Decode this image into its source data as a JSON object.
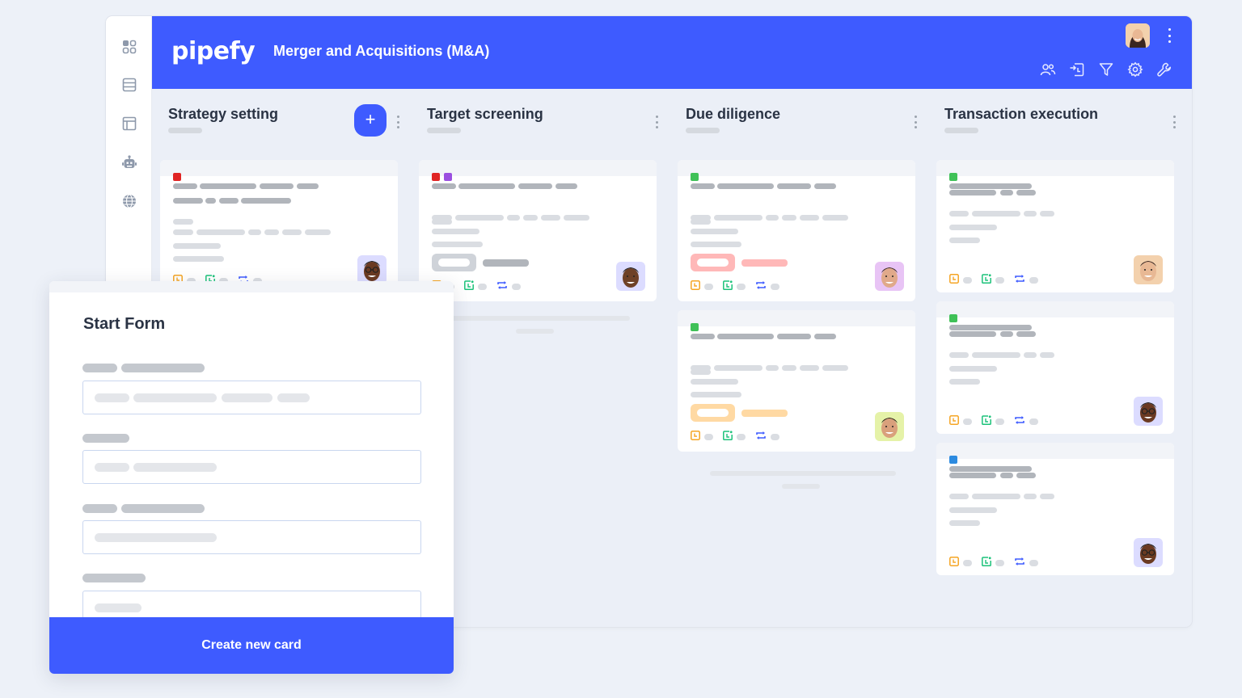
{
  "app": {
    "logo_text": "pipefy",
    "pipe_title": "Merger and Acquisitions (M&A)",
    "brand_color": "#3e5bff"
  },
  "sidebar": {
    "items": [
      {
        "icon": "apps-grid-icon"
      },
      {
        "icon": "database-icon"
      },
      {
        "icon": "layout-panel-icon"
      },
      {
        "icon": "robot-automation-icon"
      },
      {
        "icon": "globe-icon"
      }
    ]
  },
  "header": {
    "user_avatar": "user-avatar",
    "toolbar_icons": [
      "members-icon",
      "import-icon",
      "filter-icon",
      "settings-gear-icon",
      "wrench-icon"
    ]
  },
  "phases": [
    {
      "title": "Strategy setting",
      "has_add_button": true,
      "add_label": "+",
      "cards": [
        {
          "labels": [
            "#e02424"
          ],
          "avatar_bg": "#dcdcff"
        }
      ]
    },
    {
      "title": "Target screening",
      "cards": [
        {
          "labels": [
            "#e02424",
            "#9b4fe0"
          ],
          "tag_color": "#cfd3d9",
          "tag_line_color": "#b1b5bb",
          "avatar_bg": "#dcdcff"
        }
      ]
    },
    {
      "title": "Due diligence",
      "cards": [
        {
          "labels": [
            "#3fc157"
          ],
          "tag_color": "#ffb8b8",
          "tag_line_color": "#ffb8b8",
          "avatar_bg": "#e8c4f5"
        },
        {
          "labels": [
            "#3fc157"
          ],
          "tag_color": "#ffd9a3",
          "tag_line_color": "#ffd9a3",
          "avatar_bg": "#e5f2a8"
        }
      ]
    },
    {
      "title": "Transaction execution",
      "cards": [
        {
          "labels": [
            "#3fc157"
          ],
          "avatar_bg": "#f3d1ad"
        },
        {
          "labels": [
            "#3fc157"
          ],
          "avatar_bg": "#dcdcff"
        },
        {
          "labels": [
            "#2d8be0"
          ],
          "avatar_bg": "#dcdcff"
        }
      ]
    }
  ],
  "card_icons": {
    "due_date_color": "#f5a524",
    "sla_color": "#1cc27a",
    "repeat_color": "#3e5bff"
  },
  "start_form": {
    "title": "Start Form",
    "submit_label": "Create new card"
  }
}
